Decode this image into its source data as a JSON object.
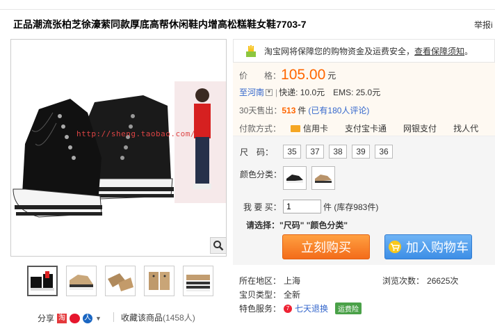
{
  "header": {
    "title": "正品潮流张柏芝徐濠萦同款厚底高帮休闲鞋内增高松糕鞋女鞋7703-7",
    "report_label": "举报i"
  },
  "gallery": {
    "watermark": "http://sheng.taobao.com/",
    "thumbnail_count": 5
  },
  "share": {
    "label": "分享",
    "fav_label": "收藏该商品",
    "fav_count": "(1458人)"
  },
  "guarantee": {
    "text": "淘宝网将保障您的购物资金及运费安全，",
    "link": "查看保障须知",
    "end": "。"
  },
  "price": {
    "label": "价　　格：",
    "value": "105.00",
    "unit": "元"
  },
  "shipping": {
    "dest": "至河南",
    "express": "快递: 10.0元",
    "ems": "EMS: 25.0元"
  },
  "sales": {
    "label": "30天售出：",
    "count": "513",
    "unit": "件",
    "comments": "(已有180人评论)"
  },
  "payment": {
    "label": "付款方式：",
    "methods": [
      "信用卡",
      "支付宝卡通",
      "网银支付",
      "找人代"
    ]
  },
  "sizes": {
    "label": "尺　码：",
    "options": [
      "35",
      "37",
      "38",
      "39",
      "36"
    ]
  },
  "colors": {
    "label": "颜色分类："
  },
  "quantity": {
    "label": "我 要 买：",
    "value": "1",
    "stock": "件 (库存983件)"
  },
  "select_hint": {
    "label": "请选择：",
    "value": "\"尺码\" \"颜色分类\""
  },
  "actions": {
    "buy_label": "立刻购买",
    "cart_label": "加入购物车"
  },
  "details": {
    "location_label": "所在地区：",
    "location": "上海",
    "views_label": "浏览次数：",
    "views": "26625次",
    "type_label": "宝贝类型：",
    "type": "全新",
    "service_label": "特色服务：",
    "return": "七天退换",
    "insurance": "运费险"
  },
  "colors_theme": {
    "price": "#ff6600",
    "buy": "#f36c1a",
    "cart": "#3d8ee6"
  }
}
